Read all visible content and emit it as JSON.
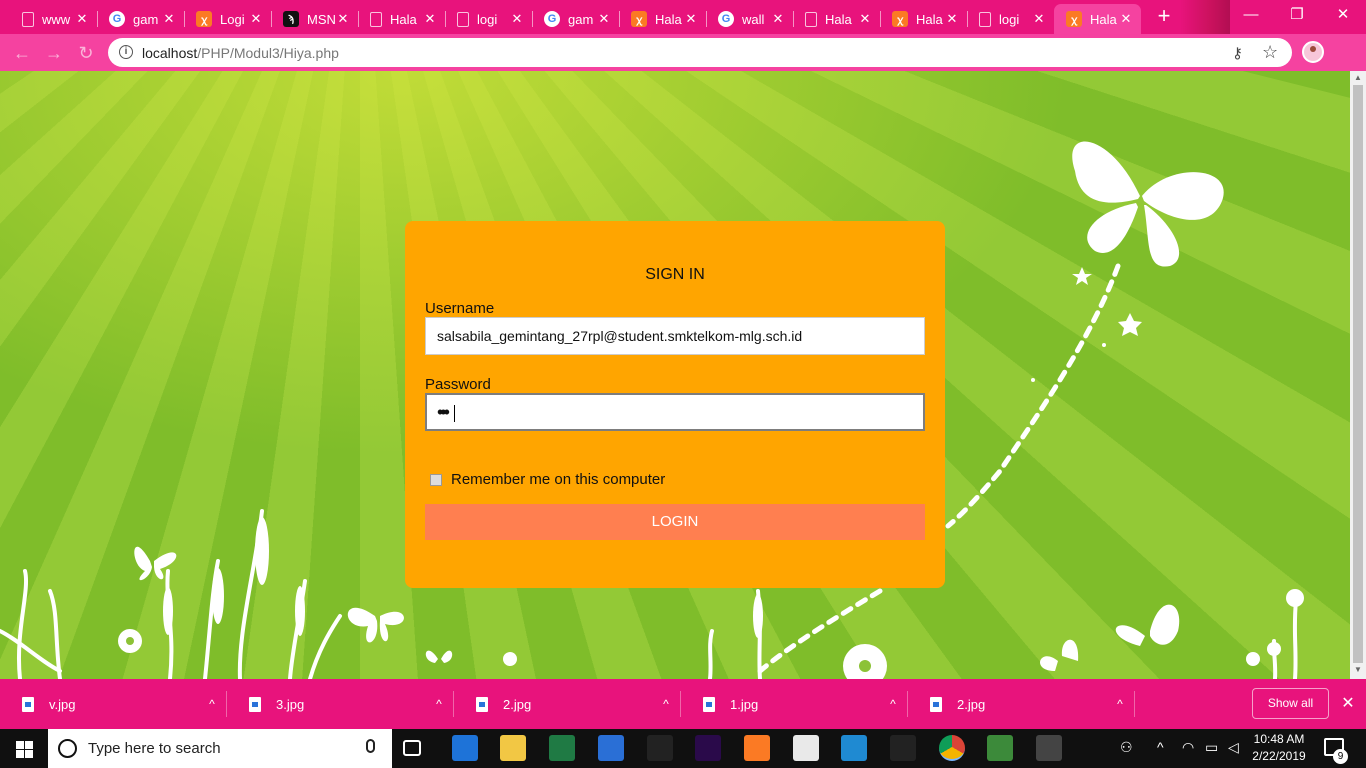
{
  "browser": {
    "tabs": [
      {
        "title": "www",
        "favicon": "document-icon"
      },
      {
        "title": "gam",
        "favicon": "google-icon"
      },
      {
        "title": "Logi",
        "favicon": "xampp-icon"
      },
      {
        "title": "MSN",
        "favicon": "msn-icon"
      },
      {
        "title": "Hala",
        "favicon": "document-icon"
      },
      {
        "title": "logi",
        "favicon": "document-icon"
      },
      {
        "title": "gam",
        "favicon": "google-icon"
      },
      {
        "title": "Hala",
        "favicon": "xampp-icon"
      },
      {
        "title": "wall",
        "favicon": "google-icon"
      },
      {
        "title": "Hala",
        "favicon": "document-icon"
      },
      {
        "title": "Hala",
        "favicon": "xampp-icon"
      },
      {
        "title": "logi",
        "favicon": "document-icon"
      },
      {
        "title": "Hala",
        "favicon": "xampp-icon",
        "active": true
      }
    ],
    "close_glyph": "✕",
    "new_tab_glyph": "+",
    "window_controls": {
      "minimize": "—",
      "restore": "❐",
      "close": "✕"
    },
    "nav": {
      "back": "←",
      "forward": "→",
      "reload": "↻"
    },
    "url_host": "localhost",
    "url_path": "/PHP/Modul3/Hiya.php",
    "theme_color": "#e8137c"
  },
  "login": {
    "title": "SIGN IN",
    "username_label": "Username",
    "username_value": "salsabila_gemintang_27rpl@student.smktelkom-mlg.sch.id",
    "password_label": "Password",
    "password_dots": "•••",
    "remember_label": "Remember me on this computer",
    "remember_checked": false,
    "login_button": "LOGIN",
    "card_color": "#ffa500",
    "button_color": "#ff7f50"
  },
  "downloads": {
    "items": [
      {
        "name": "v.jpg"
      },
      {
        "name": "3.jpg"
      },
      {
        "name": "2.jpg"
      },
      {
        "name": "1.jpg"
      },
      {
        "name": "2.jpg"
      }
    ],
    "chevron": "^",
    "show_all": "Show all",
    "close_glyph": "✕"
  },
  "taskbar": {
    "search_placeholder": "Type here to search",
    "apps": [
      "task-view-icon",
      "edge-icon",
      "file-explorer-icon",
      "excel-icon",
      "store-icon",
      "obs-icon",
      "premiere-icon",
      "xampp-icon",
      "mail-icon",
      "vscode-icon",
      "security-icon",
      "chrome-icon",
      "sublime-icon",
      "photos-icon"
    ],
    "time": "10:48 AM",
    "date": "2/22/2019",
    "notification_count": "9"
  }
}
